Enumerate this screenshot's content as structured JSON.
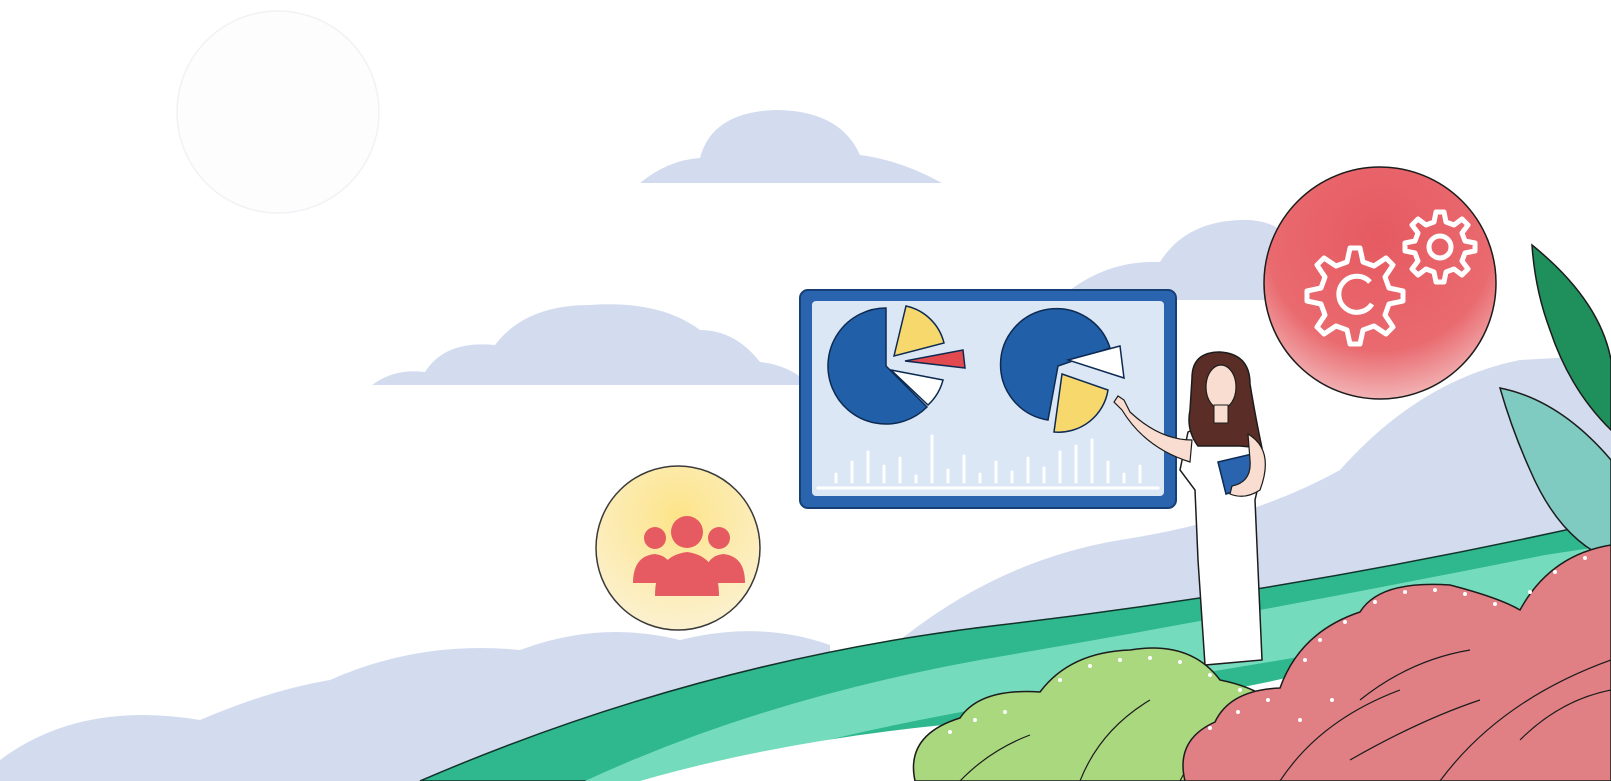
{
  "scene": {
    "colors": {
      "background": "#ffffff",
      "cloud": "#d3dcef",
      "hill_green": "#2fb88d",
      "hill_light_green": "#74dcbc",
      "board_frame": "#2a63ae",
      "board_screen": "#dbe7f5",
      "pie_blue": "#2160a8",
      "pie_yellow": "#f6d86c",
      "pie_red": "#e24a4f",
      "badge_yellow": "#fbe9a2",
      "badge_red": "#e65a61",
      "leaf_pink": "#e07f84",
      "leaf_light_green": "#a9d87f",
      "leaf_dark_green": "#1f8f5c",
      "leaf_teal": "#7fcbc2"
    },
    "icons": {
      "team": "team-icon",
      "gears": "gears-icon",
      "presenter": "presenter-figure",
      "board": "presentation-board"
    }
  }
}
